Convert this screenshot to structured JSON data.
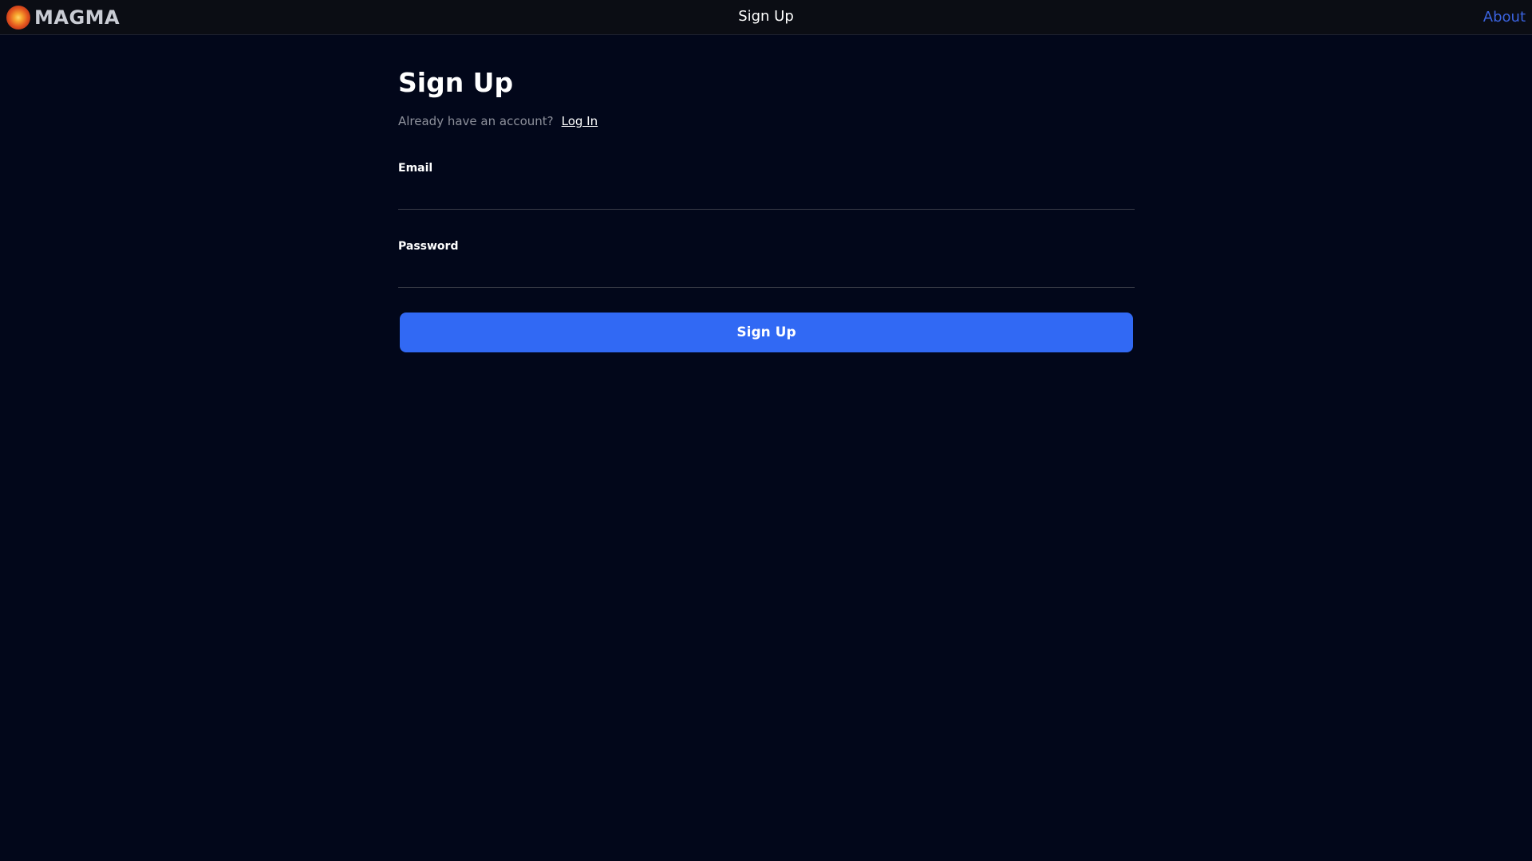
{
  "header": {
    "brand": "MAGMA",
    "title": "Sign Up",
    "about": "About"
  },
  "form": {
    "heading": "Sign Up",
    "already_text": "Already have an account?",
    "login_link": "Log In",
    "email_label": "Email",
    "email_value": "",
    "password_label": "Password",
    "password_value": "",
    "submit_label": "Sign Up"
  },
  "colors": {
    "background": "#02071a",
    "topbar": "#0b0d14",
    "accent": "#3169f4",
    "link": "#3b63e0"
  },
  "icons": {
    "logo": "magma-logo-icon"
  }
}
